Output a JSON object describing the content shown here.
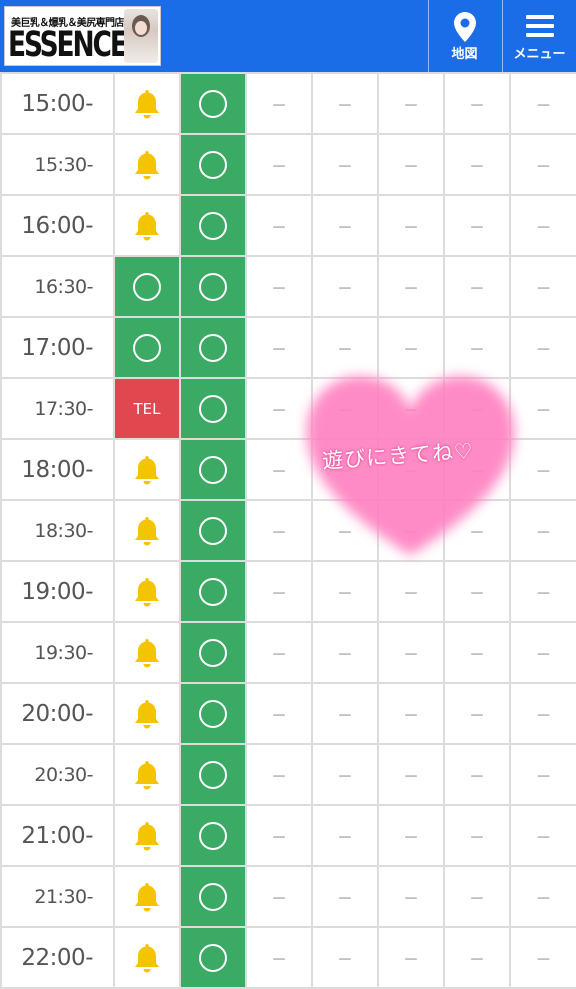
{
  "header": {
    "logo_tagline": "美巨乳＆爆乳＆美尻専門店",
    "logo_name": "ESSENCE",
    "map_label": "地図",
    "menu_label": "メニュー",
    "brand_color": "#1a6de6"
  },
  "legend": {
    "circle": "available",
    "bell": "notify",
    "dash": "unavailable"
  },
  "colors": {
    "available_green": "#3aaa64",
    "tel_red": "#e0474e",
    "bell_yellow": "#f5c400"
  },
  "schedule": [
    {
      "time": "15:00-",
      "c1": "bell",
      "c2": "circle",
      "rest": [
        "－",
        "－",
        "－",
        "－",
        "－"
      ]
    },
    {
      "time": "15:30-",
      "c1": "bell",
      "c2": "circle",
      "rest": [
        "－",
        "－",
        "－",
        "－",
        "－"
      ]
    },
    {
      "time": "16:00-",
      "c1": "bell",
      "c2": "circle",
      "rest": [
        "－",
        "－",
        "－",
        "－",
        "－"
      ]
    },
    {
      "time": "16:30-",
      "c1": "circle",
      "c2": "circle",
      "rest": [
        "－",
        "－",
        "－",
        "－",
        "－"
      ]
    },
    {
      "time": "17:00-",
      "c1": "circle",
      "c2": "circle",
      "rest": [
        "－",
        "－",
        "－",
        "－",
        "－"
      ]
    },
    {
      "time": "17:30-",
      "c1": "TEL",
      "c2": "circle",
      "rest": [
        "－",
        "－",
        "－",
        "－",
        "－"
      ]
    },
    {
      "time": "18:00-",
      "c1": "bell",
      "c2": "circle",
      "rest": [
        "－",
        "－",
        "－",
        "－",
        "－"
      ]
    },
    {
      "time": "18:30-",
      "c1": "bell",
      "c2": "circle",
      "rest": [
        "－",
        "－",
        "－",
        "－",
        "－"
      ]
    },
    {
      "time": "19:00-",
      "c1": "bell",
      "c2": "circle",
      "rest": [
        "－",
        "－",
        "－",
        "－",
        "－"
      ]
    },
    {
      "time": "19:30-",
      "c1": "bell",
      "c2": "circle",
      "rest": [
        "－",
        "－",
        "－",
        "－",
        "－"
      ]
    },
    {
      "time": "20:00-",
      "c1": "bell",
      "c2": "circle",
      "rest": [
        "－",
        "－",
        "－",
        "－",
        "－"
      ]
    },
    {
      "time": "20:30-",
      "c1": "bell",
      "c2": "circle",
      "rest": [
        "－",
        "－",
        "－",
        "－",
        "－"
      ]
    },
    {
      "time": "21:00-",
      "c1": "bell",
      "c2": "circle",
      "rest": [
        "－",
        "－",
        "－",
        "－",
        "－"
      ]
    },
    {
      "time": "21:30-",
      "c1": "bell",
      "c2": "circle",
      "rest": [
        "－",
        "－",
        "－",
        "－",
        "－"
      ]
    },
    {
      "time": "22:00-",
      "c1": "bell",
      "c2": "circle",
      "rest": [
        "－",
        "－",
        "－",
        "－",
        "－"
      ]
    }
  ],
  "sticker": {
    "text": "遊びにきてね♡",
    "shape": "pink-heart"
  }
}
